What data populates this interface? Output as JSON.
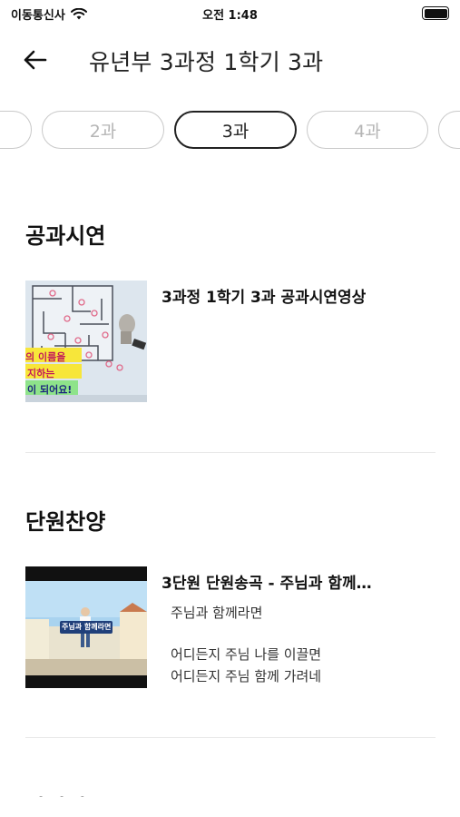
{
  "status": {
    "carrier": "이동통신사",
    "time": "오전 1:48"
  },
  "header": {
    "title": "유년부 3과정 1학기 3과"
  },
  "tabs": [
    {
      "label": "2과",
      "active": false
    },
    {
      "label": "3과",
      "active": true
    },
    {
      "label": "4과",
      "active": false
    }
  ],
  "sections": [
    {
      "title": "공과시연",
      "items": [
        {
          "title": "3과정 1학기 3과 공과시연영상",
          "thumbnail_text": [
            "의 이름을",
            "지하는",
            "이 되어요!"
          ]
        }
      ]
    },
    {
      "title": "단원찬양",
      "items": [
        {
          "title": "3단원 단원송곡 - 주님과 함께…",
          "subtitle": "주님과 함께라면",
          "lyrics": [
            "어디든지 주님 나를 이끌면",
            "어디든지 주님 함께 가려네"
          ],
          "thumbnail_text": "주님과 함께라면"
        }
      ]
    },
    {
      "title": "단원체조"
    }
  ],
  "colors": {
    "active_tab_border": "#222222",
    "inactive_tab_border": "#c9c9c9",
    "inactive_tab_text": "#b5b5b5"
  }
}
